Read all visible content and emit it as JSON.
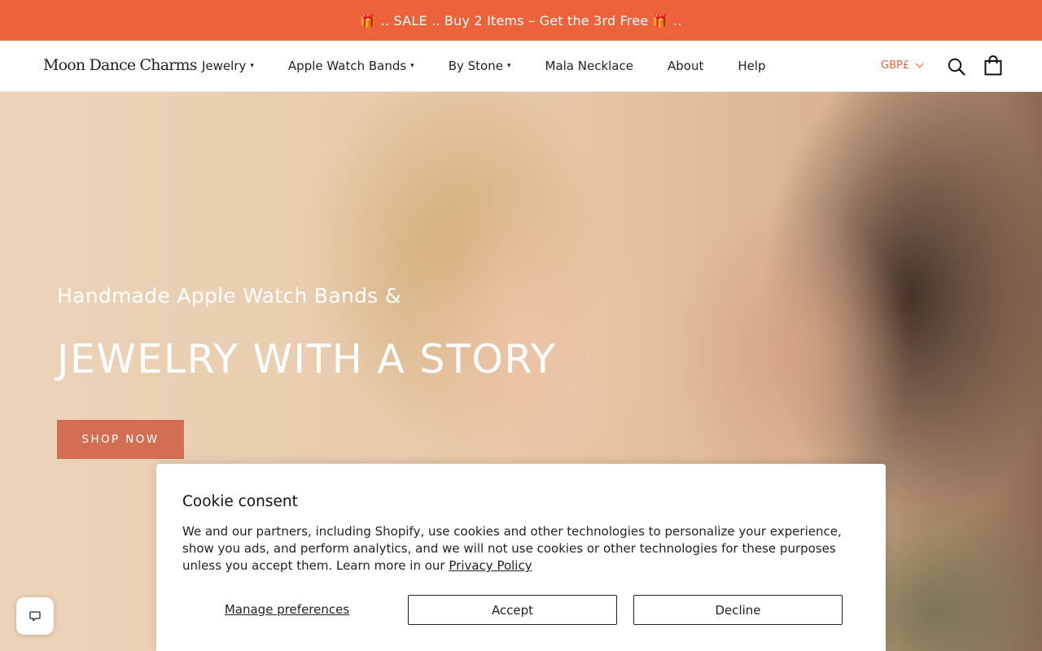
{
  "announcement": {
    "text": "🎁 .. SALE .. Buy 2 Items – Get the 3rd Free 🎁 .."
  },
  "header": {
    "logo": "Moon Dance Charms",
    "nav": [
      {
        "label": "Jewelry",
        "dropdown": true
      },
      {
        "label": "Apple Watch Bands",
        "dropdown": true
      },
      {
        "label": "By Stone",
        "dropdown": true
      },
      {
        "label": "Mala Necklace",
        "dropdown": false
      },
      {
        "label": "About",
        "dropdown": false
      },
      {
        "label": "Help",
        "dropdown": false
      }
    ],
    "caret": "▾",
    "currency": "GBP£",
    "icons": {
      "search": "search-icon",
      "cart": "shopping-bag-icon"
    }
  },
  "hero": {
    "subtitle": "Handmade Apple Watch Bands &",
    "title": "JEWELRY WITH A STORY",
    "cta": "SHOP NOW"
  },
  "cookie": {
    "title": "Cookie consent",
    "text": "We and our partners, including Shopify, use cookies and other technologies to personalize your experience, show you ads, and perform analytics, and we will not use cookies or other technologies for these purposes unless you accept them. Learn more in our ",
    "link": "Privacy Policy",
    "manage": "Manage preferences",
    "accept": "Accept",
    "decline": "Decline"
  },
  "colors": {
    "accent": "#ec633b",
    "cta": "#d46e53"
  }
}
